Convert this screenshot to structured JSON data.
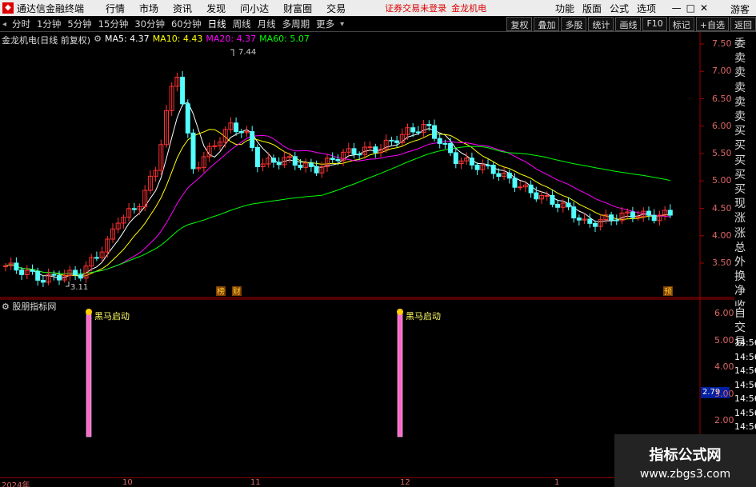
{
  "menubar": {
    "app_title": "通达信金融终端",
    "items": [
      "行情",
      "市场",
      "资讯",
      "发现",
      "问小达",
      "财富圈",
      "交易"
    ],
    "login_status": "证券交易未登录",
    "stock_title": "金龙机电",
    "right_items": [
      "功能",
      "版面",
      "公式",
      "选项"
    ],
    "guest": "游客"
  },
  "toolbar": {
    "periods": [
      "分时",
      "1分钟",
      "5分钟",
      "15分钟",
      "30分钟",
      "60分钟",
      "日线",
      "周线",
      "月线",
      "多周期",
      "更多"
    ],
    "active_period": "日线",
    "right_buttons": [
      "复权",
      "叠加",
      "多股",
      "统计",
      "画线",
      "F10",
      "标记",
      "+自选",
      "返回"
    ]
  },
  "main_info": {
    "name": "金龙机电(日线 前复权)",
    "ma5": "MA5: 4.37",
    "ma10": "MA10: 4.43",
    "ma20": "MA20: 4.37",
    "ma60": "MA60: 5.07"
  },
  "price_axis": [
    "7.50",
    "7.00",
    "6.50",
    "6.00",
    "5.50",
    "5.00",
    "4.50",
    "4.00",
    "3.50"
  ],
  "annotations": {
    "high": "7.44",
    "low": "3.11",
    "tag1": "榜",
    "tag2": "财",
    "tag3": "预"
  },
  "quote_side": [
    "委比",
    "卖五",
    "卖四",
    "卖三",
    "卖二",
    "卖一",
    "买一",
    "买二",
    "买三",
    "买四",
    "买五",
    "现价",
    "涨跌",
    "涨幅",
    "总量",
    "外盘",
    "换手",
    "净资",
    "收益"
  ],
  "sub_panel": {
    "name": "股朋指标网",
    "signal_label": "黑马启动",
    "axis": [
      "6.00",
      "5.00",
      "4.00",
      "3.00",
      "2.00"
    ],
    "current_value": "2.79",
    "side_labels": [
      "自动",
      "交易"
    ],
    "times": [
      "14:56",
      "14:56",
      "14:56",
      "14:56",
      "14:56",
      "14:56",
      "14:56"
    ]
  },
  "date_axis": [
    "2024年",
    "10",
    "11",
    "12",
    "1"
  ],
  "watermark": {
    "title": "指标公式网",
    "url": "www.zbgs3.com"
  },
  "colors": {
    "up": "#ff3232",
    "down": "#54ffff",
    "ma5": "#ffffff",
    "ma10": "#ffff00",
    "ma20": "#ff00ff",
    "ma60": "#00ff00",
    "signal": "#ff66cc"
  }
}
